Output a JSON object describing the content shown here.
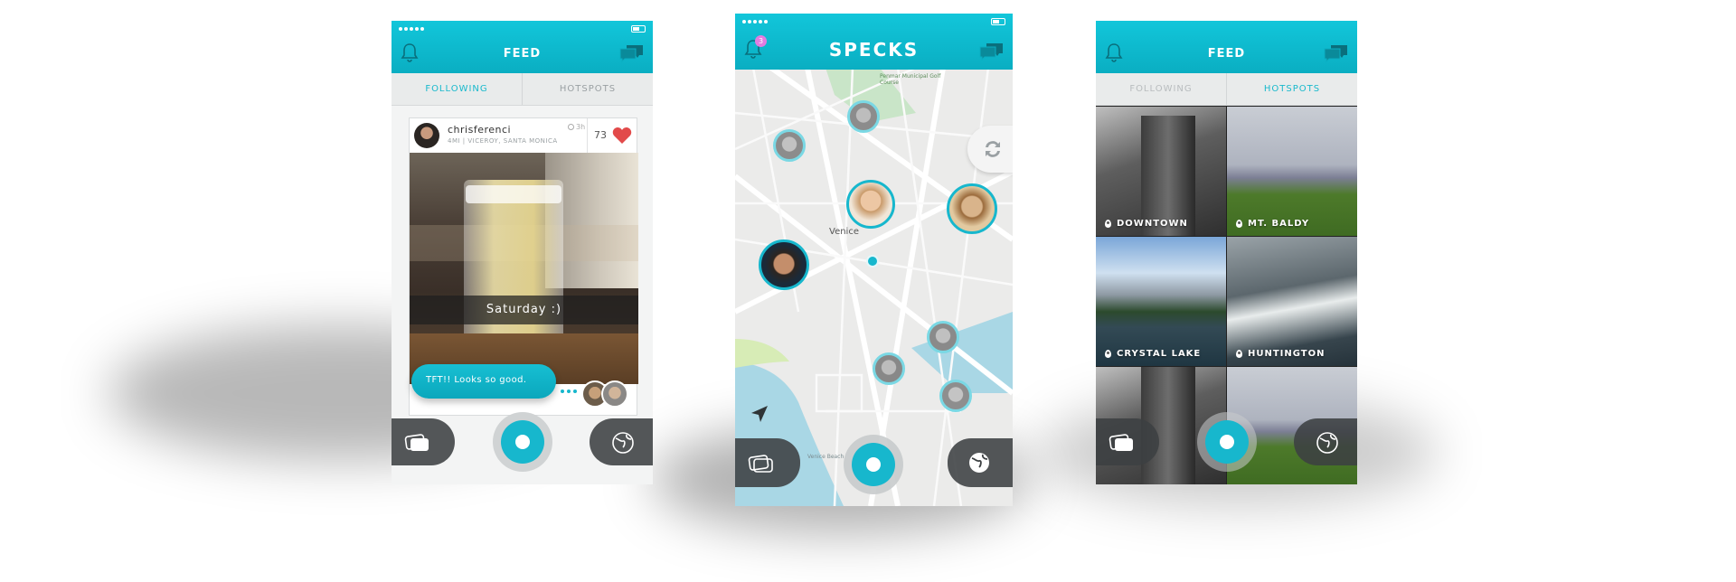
{
  "colors": {
    "accent": "#12c6da",
    "accent_dark": "#0aaec2",
    "heart": "#e24a4a",
    "bubble": "#17b7cd",
    "dark_button": "#3c4042"
  },
  "feed_screen": {
    "header": {
      "title": "FEED",
      "left_icon": "bell-icon",
      "right_icon": "chat-icon"
    },
    "tabs": [
      {
        "label": "FOLLOWING",
        "active": true
      },
      {
        "label": "HOTSPOTS",
        "active": false
      }
    ],
    "post": {
      "username": "chrisferenci",
      "location": "4MI | VICEROY, SANTA MONICA",
      "time": "3h",
      "likes": "73",
      "caption": "Saturday :)",
      "comment": "TFT!! Looks so good."
    },
    "bottom": {
      "left_icon": "cards-icon",
      "center": "capture-button",
      "right_icon": "globe-icon"
    }
  },
  "map_screen": {
    "header": {
      "title": "SPECKS",
      "left_icon": "bell-icon",
      "notification_count": "3",
      "right_icon": "chat-icon"
    },
    "map": {
      "place_labels": [
        "Venice",
        "Venice Beach",
        "Penmar Municipal Golf Course"
      ],
      "icons": [
        "refresh-icon",
        "location-arrow-icon"
      ]
    },
    "bottom": {
      "left_icon": "cards-icon",
      "center": "capture-button",
      "right_icon": "globe-icon"
    }
  },
  "hotspots_screen": {
    "header": {
      "title": "FEED",
      "left_icon": "bell-icon",
      "right_icon": "chat-icon"
    },
    "tabs": [
      {
        "label": "FOLLOWING",
        "active": false
      },
      {
        "label": "HOTSPOTS",
        "active": true
      }
    ],
    "tiles": [
      {
        "label": "DOWNTOWN"
      },
      {
        "label": "MT. BALDY"
      },
      {
        "label": "CRYSTAL LAKE"
      },
      {
        "label": "HUNTINGTON"
      }
    ],
    "bottom": {
      "left_icon": "cards-icon",
      "center": "capture-button",
      "right_icon": "globe-icon"
    }
  }
}
